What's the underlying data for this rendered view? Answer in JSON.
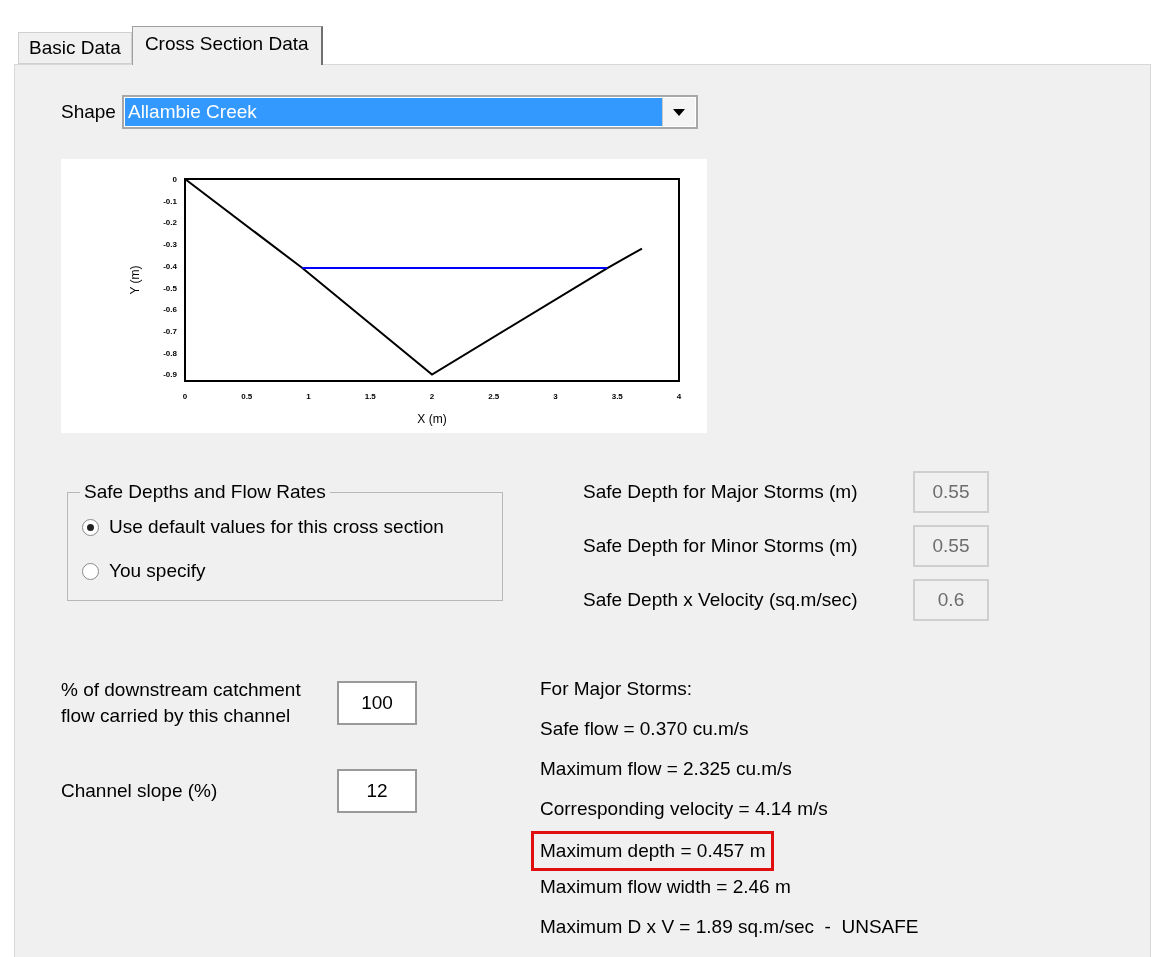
{
  "tabs": [
    {
      "label": "Basic Data",
      "selected": false
    },
    {
      "label": "Cross Section Data",
      "selected": true
    }
  ],
  "shape": {
    "label": "Shape",
    "value": "Allambie Creek"
  },
  "chart": {
    "chart_data": {
      "type": "line",
      "xlabel": "X (m)",
      "ylabel": "Y (m)",
      "x": [
        0,
        0.95,
        2,
        3.42,
        3.7
      ],
      "series": [
        {
          "color": "#000000",
          "values": [
            0,
            -0.41,
            -0.9,
            -0.41,
            -0.32
          ]
        },
        {
          "color": "#0000ff",
          "values": [
            null,
            -0.41,
            -0.41,
            -0.41,
            null
          ]
        }
      ],
      "xlim": [
        0,
        4
      ],
      "ylim": [
        -0.93,
        0
      ],
      "xticks": [
        0,
        0.5,
        1,
        1.5,
        2,
        2.5,
        3,
        3.5,
        4
      ],
      "yticks": [
        0,
        -0.1,
        -0.2,
        -0.3,
        -0.4,
        -0.5,
        -0.6,
        -0.7,
        -0.8,
        -0.9
      ]
    }
  },
  "safe_group": {
    "title": "Safe Depths and Flow Rates",
    "options": [
      {
        "label": "Use default values for this cross section",
        "selected": true
      },
      {
        "label": "You specify",
        "selected": false
      }
    ]
  },
  "safe_fields": [
    {
      "label": "Safe Depth for Major Storms (m)",
      "value": "0.55",
      "disabled": true
    },
    {
      "label": "Safe Depth for Minor Storms (m)",
      "value": "0.55",
      "disabled": true
    },
    {
      "label": "Safe Depth x Velocity (sq.m/sec)",
      "value": "0.6",
      "disabled": true
    }
  ],
  "inputs": [
    {
      "label": "% of downstream catchment flow carried by this channel",
      "value": "100"
    },
    {
      "label": "Channel slope (%)",
      "value": "12"
    }
  ],
  "results": [
    {
      "text": "For Major Storms:",
      "highlighted": false
    },
    {
      "text": "Safe flow = 0.370 cu.m/s",
      "highlighted": false
    },
    {
      "text": "Maximum flow = 2.325 cu.m/s",
      "highlighted": false
    },
    {
      "text": "Corresponding velocity = 4.14 m/s",
      "highlighted": false
    },
    {
      "text": "Maximum depth = 0.457 m",
      "highlighted": true
    },
    {
      "text": "Maximum flow width = 2.46 m",
      "highlighted": false
    },
    {
      "text": "Maximum D x V = 1.89 sq.m/sec  -  UNSAFE",
      "highlighted": false
    }
  ]
}
